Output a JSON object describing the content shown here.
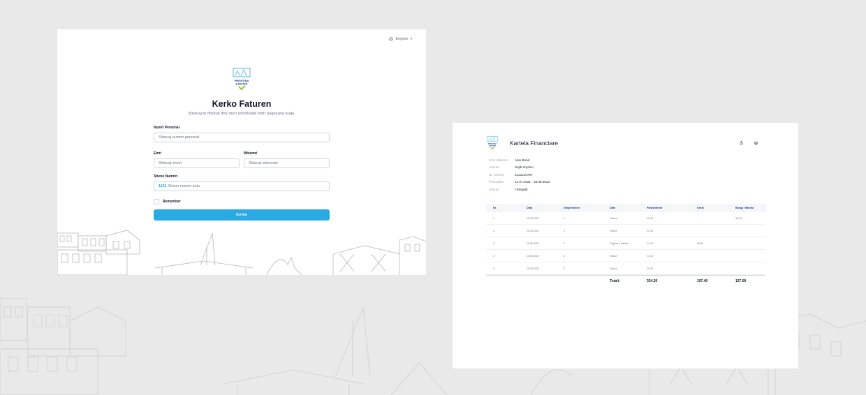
{
  "login": {
    "language": "English",
    "logo_text": [
      "PRISHTINA",
      "E PASTËR"
    ],
    "title": "Kerko Faturen",
    "subtitle": "Shkruaj te dhenat dhe merr informatat rreth pagesave tuaja.",
    "personal_number_label": "Numri Personal",
    "personal_number_placeholder": "Shkruaj numrin personal",
    "first_name_label": "Emri",
    "first_name_placeholder": "Shkruaj emrin",
    "last_name_label": "Mbiemri",
    "last_name_placeholder": "Shkruaj mbiemrin",
    "number_label": "Sheno Numrin",
    "number_prefix": "1151",
    "number_placeholder": "Sheno numrin ketu",
    "remember_label": "Remember",
    "submit_label": "Kerko"
  },
  "finance": {
    "logo_text": [
      "PRISHTINA",
      "E PASTËR"
    ],
    "title": "Kartela Financiare",
    "info": [
      {
        "key": "Emri Mbiemri",
        "value": "Alan Bond"
      },
      {
        "key": "Adresa",
        "value": "Sejdi Kryezlu"
      },
      {
        "key": "Nr. Klientit",
        "value": "2121210707"
      },
      {
        "key": "Perioudha",
        "value": "21.07.2021 - 25.09.2023"
      },
      {
        "key": "Statusi",
        "value": "I Rregullt"
      }
    ],
    "columns": [
      "Nr.",
      "Data",
      "Nënpërkimet",
      "Date",
      "Parashtrimit",
      "Kredi",
      "Borgji i Mbetur"
    ],
    "rows": [
      [
        "1",
        "11.05.2023",
        "1",
        "Fatura",
        "14.15",
        "",
        "30.39"
      ],
      [
        "2",
        "11.05.2023",
        "1",
        "Fatura",
        "14.15",
        "",
        ""
      ],
      [
        "3",
        "11.05.2023",
        "2",
        "Pagesa e faturës",
        "14.15",
        "69.80",
        ""
      ],
      [
        "4",
        "11.05.2023",
        "3",
        "Fatura",
        "14.15",
        "",
        ""
      ],
      [
        "5",
        "11.05.2023",
        "3",
        "Fatura",
        "14.15",
        "",
        ""
      ]
    ],
    "total_label": "Totali:",
    "totals": [
      "324.30",
      "197.40",
      "127.00"
    ]
  },
  "colors": {
    "accent": "#29aae2",
    "brand_green": "#8dc63f",
    "brand_navy": "#1e3a8a"
  }
}
